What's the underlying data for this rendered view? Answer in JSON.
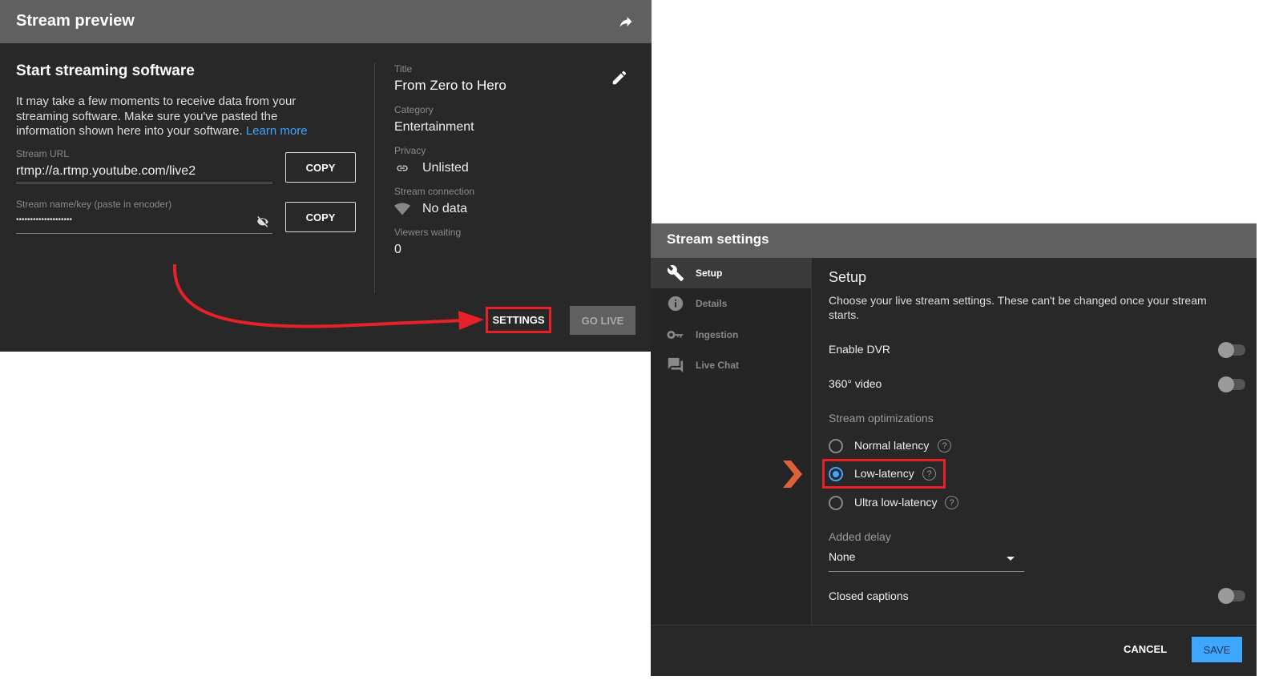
{
  "preview": {
    "title": "Stream preview",
    "heading": "Start streaming software",
    "description": "It may take a few moments to receive data from your streaming software. Make sure you've pasted the information shown here into your software.",
    "learn_more": "Learn more",
    "url_label": "Stream URL",
    "url_value": "rtmp://a.rtmp.youtube.com/live2",
    "key_label": "Stream name/key (paste in encoder)",
    "key_value": "••••••••••••••••••••",
    "copy_label": "COPY",
    "title_label": "Title",
    "title_value": "From Zero to Hero",
    "category_label": "Category",
    "category_value": "Entertainment",
    "privacy_label": "Privacy",
    "privacy_value": "Unlisted",
    "connection_label": "Stream connection",
    "connection_value": "No data",
    "viewers_label": "Viewers waiting",
    "viewers_value": "0",
    "settings_button": "SETTINGS",
    "go_live_button": "GO LIVE"
  },
  "settings": {
    "title": "Stream settings",
    "sidebar": [
      {
        "label": "Setup",
        "icon": "wrench-icon"
      },
      {
        "label": "Details",
        "icon": "info-icon"
      },
      {
        "label": "Ingestion",
        "icon": "key-icon"
      },
      {
        "label": "Live Chat",
        "icon": "chat-icon"
      }
    ],
    "heading": "Setup",
    "description": "Choose your live stream settings. These can't be changed once your stream starts.",
    "dvr": "Enable DVR",
    "video360": "360° video",
    "optimizations_label": "Stream optimizations",
    "options": [
      "Normal latency",
      "Low-latency",
      "Ultra low-latency"
    ],
    "selected": "Low-latency",
    "help": "?",
    "delay_label": "Added delay",
    "delay_value": "None",
    "captions": "Closed captions",
    "cancel": "CANCEL",
    "save": "SAVE"
  },
  "colors": {
    "accent": "#3ea6ff",
    "highlight": "#e8202a",
    "pointer": "#e0603a"
  }
}
